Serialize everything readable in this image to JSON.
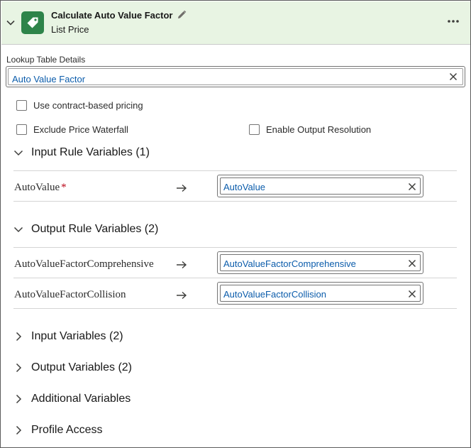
{
  "header": {
    "title": "Calculate Auto Value Factor",
    "subtitle": "List Price",
    "icon": "price-tag-icon",
    "accent_color": "#2e844a",
    "background_color": "#e8f4e3"
  },
  "lookup": {
    "label": "Lookup Table Details",
    "value": "Auto Value Factor"
  },
  "options": {
    "contract_pricing": "Use contract-based pricing",
    "exclude_waterfall": "Exclude Price Waterfall",
    "enable_output": "Enable Output Resolution"
  },
  "input_rule": {
    "title": "Input Rule Variables (1)",
    "rows": [
      {
        "name": "AutoValue",
        "required": "*",
        "value": "AutoValue"
      }
    ]
  },
  "output_rule": {
    "title": "Output Rule Variables (2)",
    "rows": [
      {
        "name": "AutoValueFactorComprehensive",
        "value": "AutoValueFactorComprehensive"
      },
      {
        "name": "AutoValueFactorCollision",
        "value": "AutoValueFactorCollision"
      }
    ]
  },
  "collapsed_sections": [
    {
      "title": "Input Variables (2)"
    },
    {
      "title": "Output Variables (2)"
    },
    {
      "title": "Additional Variables"
    },
    {
      "title": "Profile Access"
    }
  ]
}
